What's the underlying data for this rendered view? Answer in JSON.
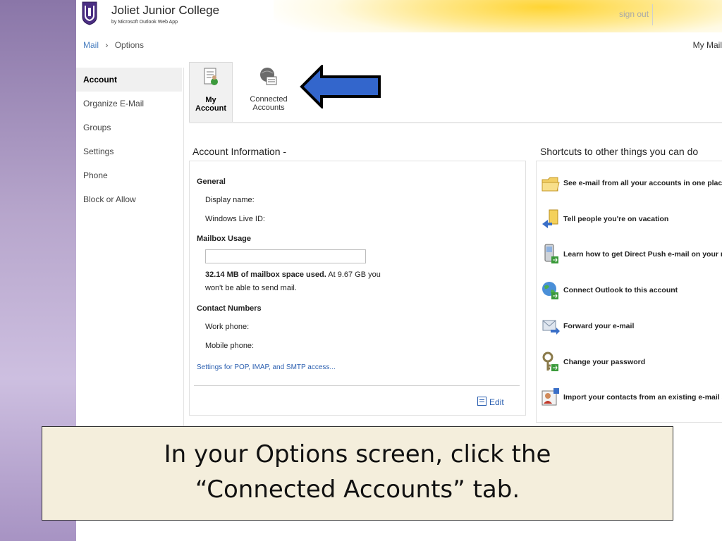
{
  "header": {
    "college_name": "Joliet Junior College",
    "byline": "by Microsoft Outlook Web App",
    "sign_out": "sign out"
  },
  "breadcrumb": {
    "root": "Mail",
    "separator": "›",
    "current": "Options"
  },
  "my_mail": "My Mail",
  "nav": {
    "items": [
      {
        "label": "Account"
      },
      {
        "label": "Organize E-Mail"
      },
      {
        "label": "Groups"
      },
      {
        "label": "Settings"
      },
      {
        "label": "Phone"
      },
      {
        "label": "Block or Allow"
      }
    ]
  },
  "tabs": {
    "my_account": "My Account",
    "connected_accounts": "Connected Accounts"
  },
  "account_info": {
    "title": "Account Information -",
    "general_heading": "General",
    "display_name": "Display name:",
    "windows_live_id": "Windows Live ID:",
    "mailbox_heading": "Mailbox Usage",
    "usage_bold": "32.14 MB of mailbox space used.",
    "usage_rest": " At 9.67 GB you",
    "usage_line2": "won't be able to send mail.",
    "contact_heading": "Contact Numbers",
    "work_phone": "Work phone:",
    "mobile_phone": "Mobile phone:",
    "pop_link": "Settings for POP, IMAP, and SMTP access...",
    "edit": "Edit"
  },
  "shortcuts": {
    "title": "Shortcuts to other things you can do",
    "items": [
      {
        "label": "See e-mail from all your accounts in one place",
        "icon": "folder-icon"
      },
      {
        "label": "Tell people you're on vacation",
        "icon": "vacation-icon"
      },
      {
        "label": "Learn how to get Direct Push e-mail on your mobile pl",
        "icon": "mobile-phone-icon"
      },
      {
        "label": "Connect Outlook to this account",
        "icon": "globe-connect-icon"
      },
      {
        "label": "Forward your e-mail",
        "icon": "forward-mail-icon"
      },
      {
        "label": "Change your password",
        "icon": "keys-icon"
      },
      {
        "label": "Import your contacts from an existing e-mail account",
        "icon": "contact-card-icon"
      }
    ]
  },
  "caption": {
    "line1": "In your Options screen, click the",
    "line2": "“Connected Accounts” tab."
  },
  "colors": {
    "accent": "#4a7fc0",
    "link": "#2b5fb0",
    "arrow": "#3366cc",
    "caption_bg": "#f4eedc"
  }
}
